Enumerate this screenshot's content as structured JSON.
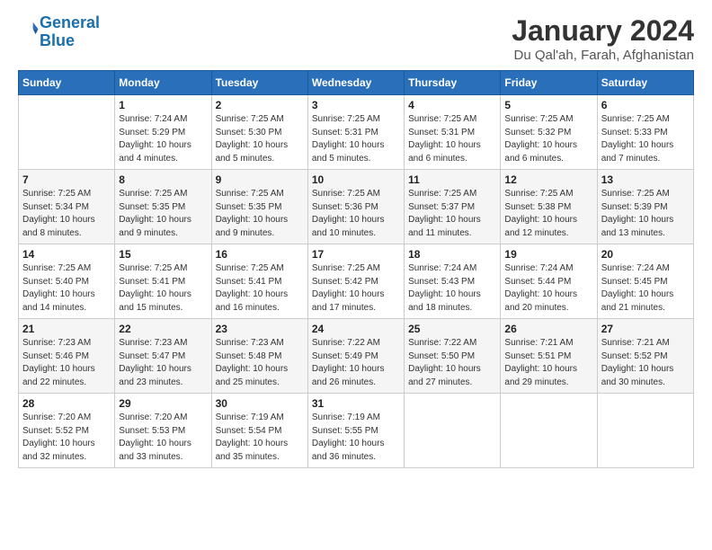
{
  "logo": {
    "line1": "General",
    "line2": "Blue"
  },
  "title": "January 2024",
  "location": "Du Qal'ah, Farah, Afghanistan",
  "days_of_week": [
    "Sunday",
    "Monday",
    "Tuesday",
    "Wednesday",
    "Thursday",
    "Friday",
    "Saturday"
  ],
  "weeks": [
    [
      {
        "day": null,
        "info": null
      },
      {
        "day": "1",
        "info": "Sunrise: 7:24 AM\nSunset: 5:29 PM\nDaylight: 10 hours\nand 4 minutes."
      },
      {
        "day": "2",
        "info": "Sunrise: 7:25 AM\nSunset: 5:30 PM\nDaylight: 10 hours\nand 5 minutes."
      },
      {
        "day": "3",
        "info": "Sunrise: 7:25 AM\nSunset: 5:31 PM\nDaylight: 10 hours\nand 5 minutes."
      },
      {
        "day": "4",
        "info": "Sunrise: 7:25 AM\nSunset: 5:31 PM\nDaylight: 10 hours\nand 6 minutes."
      },
      {
        "day": "5",
        "info": "Sunrise: 7:25 AM\nSunset: 5:32 PM\nDaylight: 10 hours\nand 6 minutes."
      },
      {
        "day": "6",
        "info": "Sunrise: 7:25 AM\nSunset: 5:33 PM\nDaylight: 10 hours\nand 7 minutes."
      }
    ],
    [
      {
        "day": "7",
        "info": "Sunrise: 7:25 AM\nSunset: 5:34 PM\nDaylight: 10 hours\nand 8 minutes."
      },
      {
        "day": "8",
        "info": "Sunrise: 7:25 AM\nSunset: 5:35 PM\nDaylight: 10 hours\nand 9 minutes."
      },
      {
        "day": "9",
        "info": "Sunrise: 7:25 AM\nSunset: 5:35 PM\nDaylight: 10 hours\nand 9 minutes."
      },
      {
        "day": "10",
        "info": "Sunrise: 7:25 AM\nSunset: 5:36 PM\nDaylight: 10 hours\nand 10 minutes."
      },
      {
        "day": "11",
        "info": "Sunrise: 7:25 AM\nSunset: 5:37 PM\nDaylight: 10 hours\nand 11 minutes."
      },
      {
        "day": "12",
        "info": "Sunrise: 7:25 AM\nSunset: 5:38 PM\nDaylight: 10 hours\nand 12 minutes."
      },
      {
        "day": "13",
        "info": "Sunrise: 7:25 AM\nSunset: 5:39 PM\nDaylight: 10 hours\nand 13 minutes."
      }
    ],
    [
      {
        "day": "14",
        "info": "Sunrise: 7:25 AM\nSunset: 5:40 PM\nDaylight: 10 hours\nand 14 minutes."
      },
      {
        "day": "15",
        "info": "Sunrise: 7:25 AM\nSunset: 5:41 PM\nDaylight: 10 hours\nand 15 minutes."
      },
      {
        "day": "16",
        "info": "Sunrise: 7:25 AM\nSunset: 5:41 PM\nDaylight: 10 hours\nand 16 minutes."
      },
      {
        "day": "17",
        "info": "Sunrise: 7:25 AM\nSunset: 5:42 PM\nDaylight: 10 hours\nand 17 minutes."
      },
      {
        "day": "18",
        "info": "Sunrise: 7:24 AM\nSunset: 5:43 PM\nDaylight: 10 hours\nand 18 minutes."
      },
      {
        "day": "19",
        "info": "Sunrise: 7:24 AM\nSunset: 5:44 PM\nDaylight: 10 hours\nand 20 minutes."
      },
      {
        "day": "20",
        "info": "Sunrise: 7:24 AM\nSunset: 5:45 PM\nDaylight: 10 hours\nand 21 minutes."
      }
    ],
    [
      {
        "day": "21",
        "info": "Sunrise: 7:23 AM\nSunset: 5:46 PM\nDaylight: 10 hours\nand 22 minutes."
      },
      {
        "day": "22",
        "info": "Sunrise: 7:23 AM\nSunset: 5:47 PM\nDaylight: 10 hours\nand 23 minutes."
      },
      {
        "day": "23",
        "info": "Sunrise: 7:23 AM\nSunset: 5:48 PM\nDaylight: 10 hours\nand 25 minutes."
      },
      {
        "day": "24",
        "info": "Sunrise: 7:22 AM\nSunset: 5:49 PM\nDaylight: 10 hours\nand 26 minutes."
      },
      {
        "day": "25",
        "info": "Sunrise: 7:22 AM\nSunset: 5:50 PM\nDaylight: 10 hours\nand 27 minutes."
      },
      {
        "day": "26",
        "info": "Sunrise: 7:21 AM\nSunset: 5:51 PM\nDaylight: 10 hours\nand 29 minutes."
      },
      {
        "day": "27",
        "info": "Sunrise: 7:21 AM\nSunset: 5:52 PM\nDaylight: 10 hours\nand 30 minutes."
      }
    ],
    [
      {
        "day": "28",
        "info": "Sunrise: 7:20 AM\nSunset: 5:52 PM\nDaylight: 10 hours\nand 32 minutes."
      },
      {
        "day": "29",
        "info": "Sunrise: 7:20 AM\nSunset: 5:53 PM\nDaylight: 10 hours\nand 33 minutes."
      },
      {
        "day": "30",
        "info": "Sunrise: 7:19 AM\nSunset: 5:54 PM\nDaylight: 10 hours\nand 35 minutes."
      },
      {
        "day": "31",
        "info": "Sunrise: 7:19 AM\nSunset: 5:55 PM\nDaylight: 10 hours\nand 36 minutes."
      },
      {
        "day": null,
        "info": null
      },
      {
        "day": null,
        "info": null
      },
      {
        "day": null,
        "info": null
      }
    ]
  ]
}
